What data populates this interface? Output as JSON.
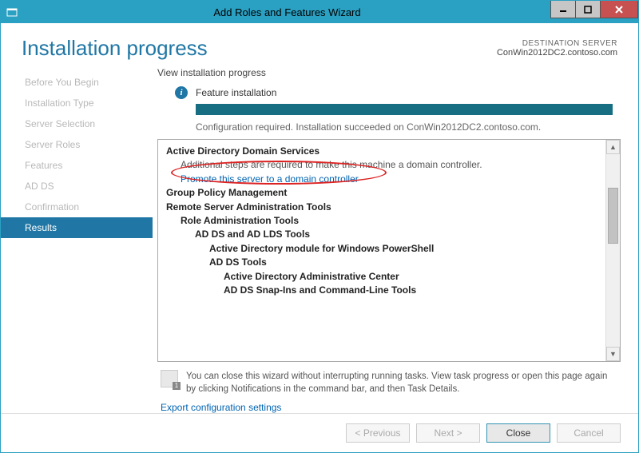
{
  "window": {
    "title": "Add Roles and Features Wizard"
  },
  "header": {
    "page_title": "Installation progress",
    "dest_label": "DESTINATION SERVER",
    "dest_server": "ConWin2012DC2.contoso.com"
  },
  "sidebar": {
    "steps": [
      "Before You Begin",
      "Installation Type",
      "Server Selection",
      "Server Roles",
      "Features",
      "AD DS",
      "Confirmation",
      "Results"
    ],
    "active_index": 7
  },
  "main": {
    "view_label": "View installation progress",
    "feature_label": "Feature installation",
    "config_msg": "Configuration required. Installation succeeded on ConWin2012DC2.contoso.com.",
    "results": {
      "adds_heading": "Active Directory Domain Services",
      "adds_sub": "Additional steps are required to make this machine a domain controller.",
      "promote_link": "Promote this server to a domain controller",
      "gpm": "Group Policy Management",
      "rsat": "Remote Server Administration Tools",
      "rat": "Role Administration Tools",
      "adds_lds": "AD DS and AD LDS Tools",
      "ad_ps": "Active Directory module for Windows PowerShell",
      "adds_tools": "AD DS Tools",
      "adac": "Active Directory Administrative Center",
      "snapins": "AD DS Snap-Ins and Command-Line Tools"
    },
    "footer_note": "You can close this wizard without interrupting running tasks. View task progress or open this page again by clicking Notifications in the command bar, and then Task Details.",
    "export_link": "Export configuration settings"
  },
  "buttons": {
    "previous": "< Previous",
    "next": "Next >",
    "close": "Close",
    "cancel": "Cancel"
  }
}
